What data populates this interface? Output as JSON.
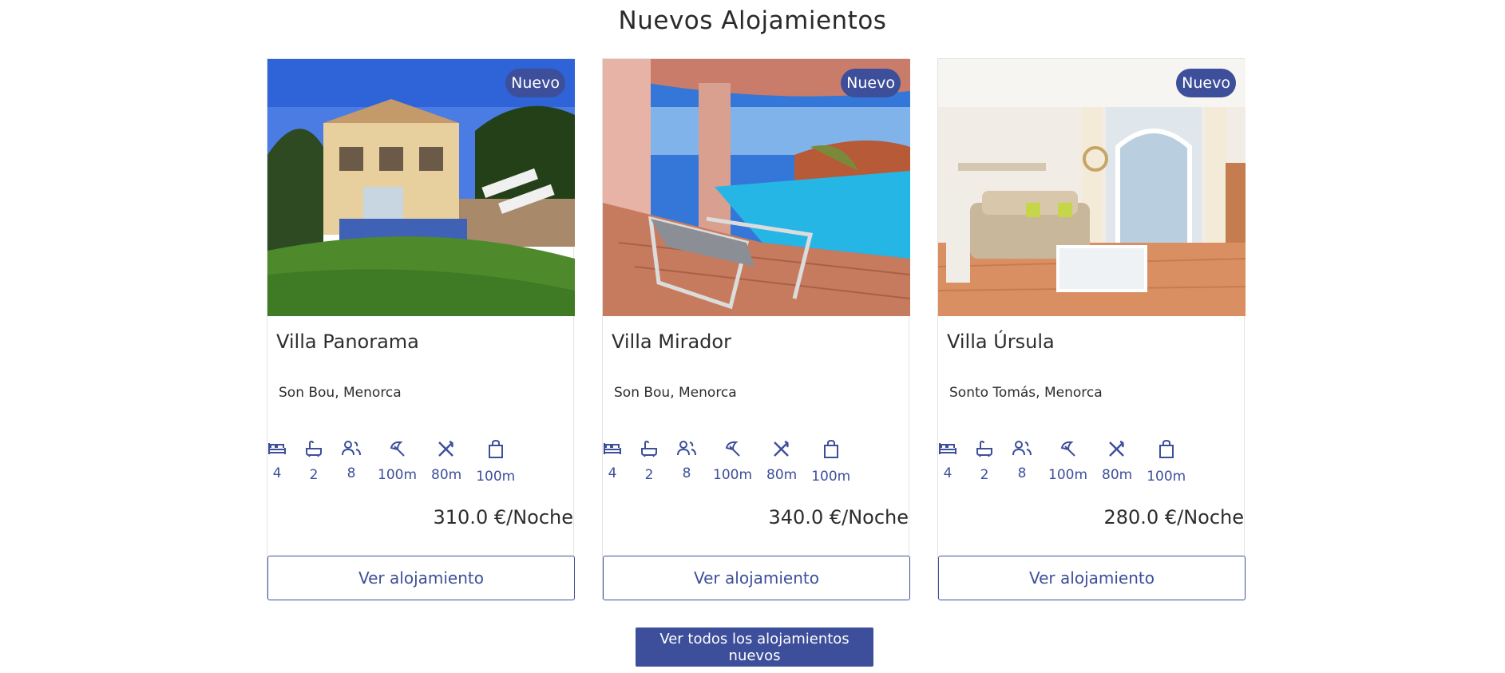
{
  "section": {
    "title": "Nuevos Alojamientos"
  },
  "colors": {
    "accent": "#3d4f9a",
    "text": "#2d2d2d"
  },
  "properties": [
    {
      "badge": "Nuevo",
      "name": "Villa Panorama",
      "location": "Son Bou, Menorca",
      "features": [
        {
          "icon": "bed-icon",
          "value": "4"
        },
        {
          "icon": "bathtub-icon",
          "value": "2"
        },
        {
          "icon": "people-icon",
          "value": "8"
        },
        {
          "icon": "beach-umbrella-icon",
          "value": "100m"
        },
        {
          "icon": "restaurant-icon",
          "value": "80m"
        },
        {
          "icon": "shopping-bag-icon",
          "value": "100m"
        }
      ],
      "price": "310.0 €/Noche",
      "button": "Ver alojamiento"
    },
    {
      "badge": "Nuevo",
      "name": "Villa Mirador",
      "location": "Son Bou, Menorca",
      "features": [
        {
          "icon": "bed-icon",
          "value": "4"
        },
        {
          "icon": "bathtub-icon",
          "value": "2"
        },
        {
          "icon": "people-icon",
          "value": "8"
        },
        {
          "icon": "beach-umbrella-icon",
          "value": "100m"
        },
        {
          "icon": "restaurant-icon",
          "value": "80m"
        },
        {
          "icon": "shopping-bag-icon",
          "value": "100m"
        }
      ],
      "price": "340.0 €/Noche",
      "button": "Ver alojamiento"
    },
    {
      "badge": "Nuevo",
      "name": "Villa Úrsula",
      "location": "Sonto Tomás, Menorca",
      "features": [
        {
          "icon": "bed-icon",
          "value": "4"
        },
        {
          "icon": "bathtub-icon",
          "value": "2"
        },
        {
          "icon": "people-icon",
          "value": "8"
        },
        {
          "icon": "beach-umbrella-icon",
          "value": "100m"
        },
        {
          "icon": "restaurant-icon",
          "value": "80m"
        },
        {
          "icon": "shopping-bag-icon",
          "value": "100m"
        }
      ],
      "price": "280.0 €/Noche",
      "button": "Ver alojamiento"
    }
  ],
  "footer_button": "Ver todos los alojamientos nuevos"
}
